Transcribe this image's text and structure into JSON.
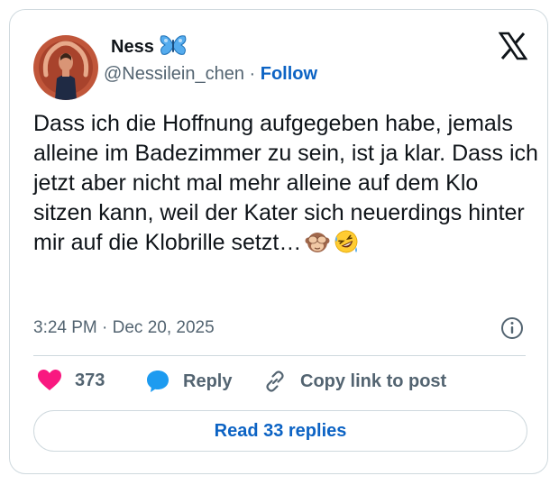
{
  "author": {
    "display_name": "Ness",
    "name_emoji_icon": "butterfly-icon",
    "handle": "@Nessilein_chen",
    "separator": "·",
    "follow_label": "Follow",
    "avatar_icon": "user-avatar"
  },
  "platform_icon": "x-logo-icon",
  "tweet": {
    "text": "Dass ich die Hoffnung aufgegeben habe, jemals alleine im Badezimmer zu sein, ist ja klar. Dass ich jetzt aber nicht mal mehr alleine auf dem Klo sitzen kann, weil der Kater sich neuerdings hinter mir auf die Klobrille setzt…",
    "trailing_emoji_icons": [
      "see-no-evil-monkey-icon",
      "rolling-on-floor-laughing-icon"
    ],
    "timestamp": "3:24 PM · Dec 20, 2025"
  },
  "actions": {
    "like_count": "373",
    "reply_label": "Reply",
    "copy_link_label": "Copy link to post"
  },
  "read_replies_label": "Read 33 replies",
  "colors": {
    "accent": "#0c63c4",
    "like": "#f91880",
    "reply": "#1d9bf0",
    "text": "#0f1419",
    "muted": "#536471",
    "border": "#cfd9de"
  }
}
